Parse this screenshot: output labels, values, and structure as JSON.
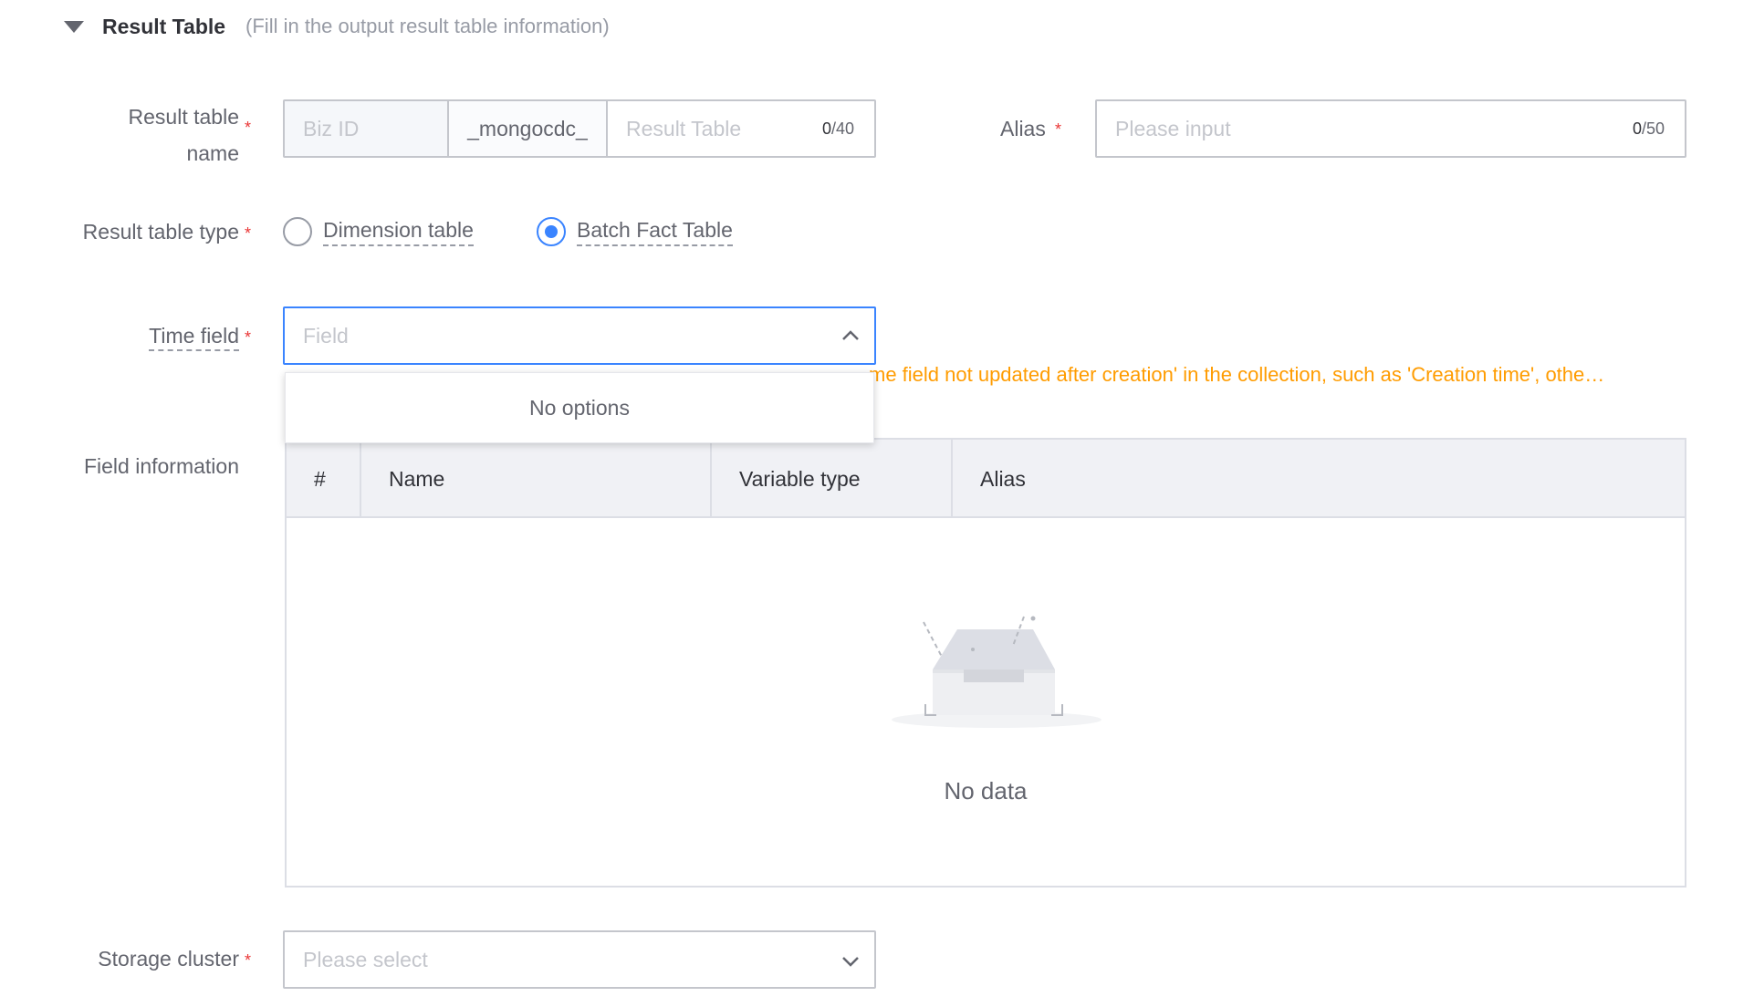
{
  "section": {
    "title": "Result Table",
    "subtitle": "(Fill in the output result table information)",
    "toggle_icon": "caret-down-icon"
  },
  "result_table_name": {
    "label_line1": "Result table",
    "label_line2": "name",
    "biz_id_placeholder": "Biz ID",
    "middle_segment": "_mongocdc_",
    "table_placeholder": "Result Table",
    "counter_current": "0",
    "counter_max": "/40"
  },
  "alias": {
    "label": "Alias",
    "placeholder": "Please input",
    "counter_current": "0",
    "counter_max": "/50"
  },
  "result_table_type": {
    "label": "Result table type",
    "options": [
      {
        "label": "Dimension table",
        "checked": false
      },
      {
        "label": "Batch Fact Table",
        "checked": true
      }
    ]
  },
  "time_field": {
    "label": "Time field",
    "placeholder": "Field",
    "warning": "me field not updated after creation' in the collection, such as 'Creation time', othe…",
    "dropdown_empty": "No options",
    "chevron_icon": "chevron-up-icon"
  },
  "field_information": {
    "label": "Field information",
    "columns": [
      "#",
      "Name",
      "Variable type",
      "Alias"
    ],
    "empty_text": "No data",
    "empty_icon": "empty-box-icon"
  },
  "storage_cluster": {
    "label": "Storage cluster",
    "placeholder": "Please select",
    "chevron_icon": "chevron-down-icon"
  },
  "required_mark": "*",
  "colors": {
    "primary": "#3a84ff",
    "required": "#ea3636",
    "warning": "#ff9c01",
    "border": "#c4c6cc",
    "table_header_bg": "#f0f1f5"
  }
}
